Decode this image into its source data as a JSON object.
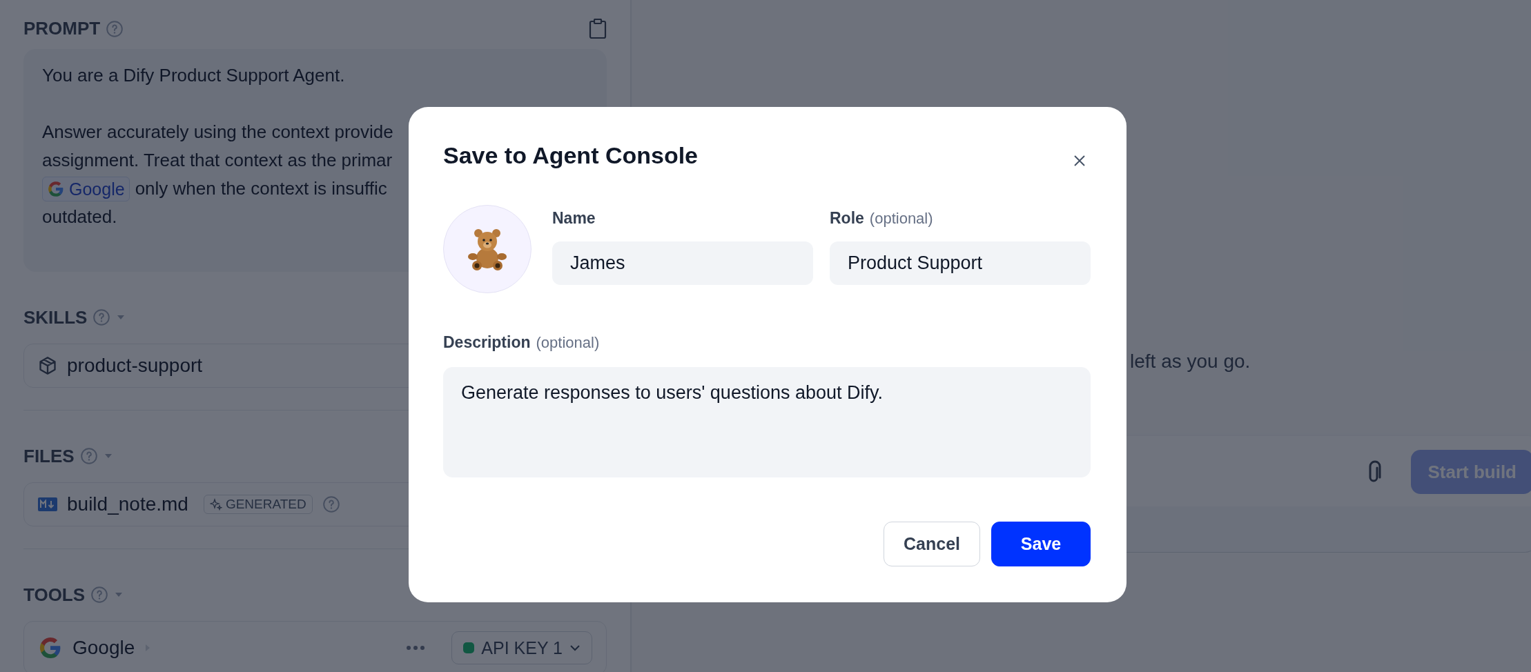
{
  "prompt": {
    "title": "PROMPT",
    "paragraphs": [
      {
        "lines": [
          {
            "text": "You are a Dify Product Support Agent."
          }
        ]
      },
      {
        "lines": [
          {
            "text": "Answer accurately using the context provide"
          },
          {
            "text": "assignment. Treat that context as the primar"
          },
          {
            "chip": "Google",
            "text": "only when the context is insuffic"
          },
          {
            "text": "outdated."
          }
        ]
      }
    ]
  },
  "sections": [
    {
      "title": "SKILLS",
      "kind": "skill",
      "items": [
        {
          "name": "product-support"
        }
      ]
    },
    {
      "title": "FILES",
      "kind": "file",
      "items": [
        {
          "name": "build_note.md",
          "badge": "GENERATED"
        }
      ]
    },
    {
      "title": "TOOLS",
      "kind": "tool",
      "items": [
        {
          "name": "Google",
          "credential": "API KEY 1"
        }
      ]
    }
  ],
  "canvas": {
    "hint": "left as you go.",
    "start_button": {
      "label": "Start build",
      "disabled": true
    }
  },
  "dialog": {
    "title": "Save to Agent Console",
    "name": {
      "label": "Name",
      "value": "James"
    },
    "role": {
      "label": "Role",
      "optional": "(optional)",
      "value": "Product Support"
    },
    "description": {
      "label": "Description",
      "optional": "(optional)",
      "value": "Generate responses to users' questions about Dify."
    },
    "buttons": [
      {
        "label": "Cancel",
        "kind": "secondary"
      },
      {
        "label": "Save",
        "kind": "primary"
      }
    ]
  }
}
